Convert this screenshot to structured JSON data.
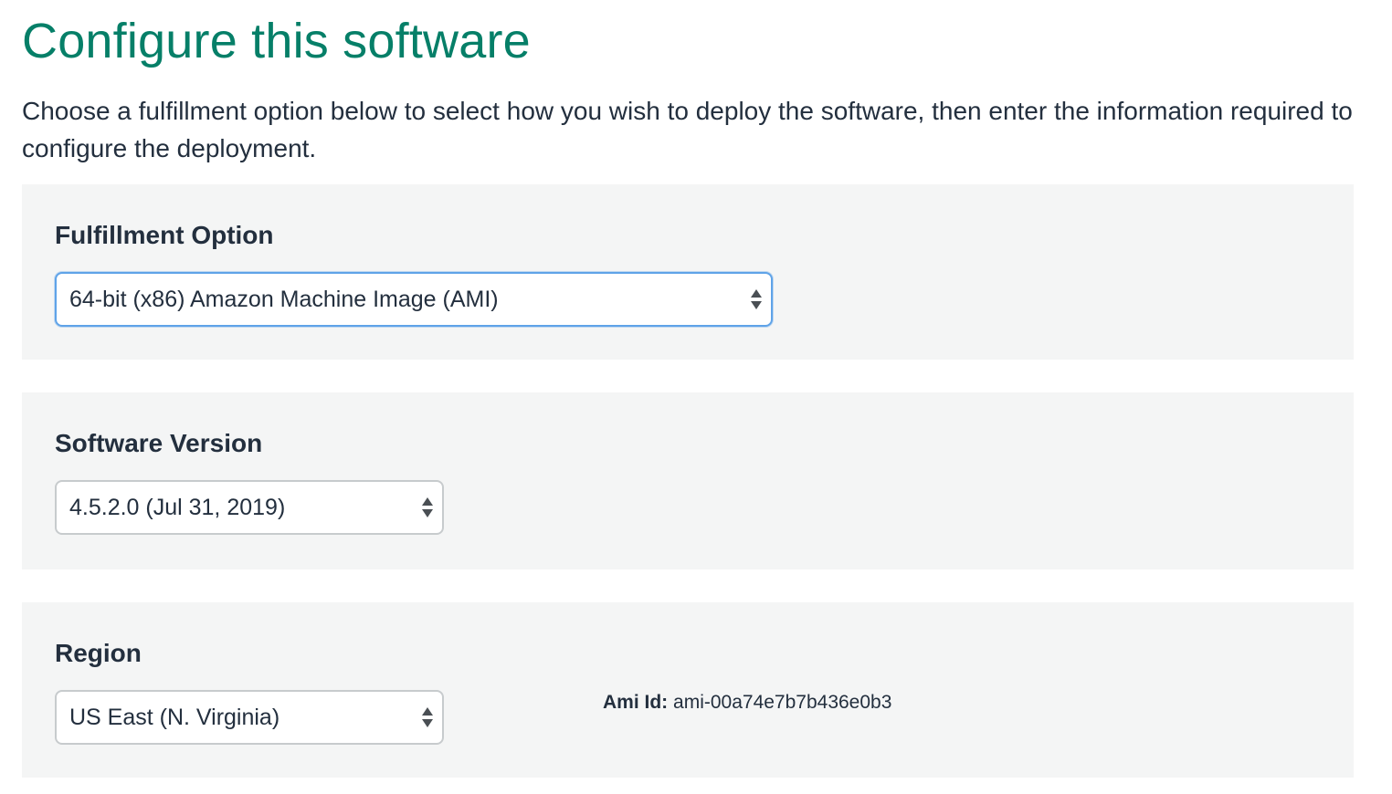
{
  "page": {
    "title": "Configure this software",
    "intro": "Choose a fulfillment option below to select how you wish to deploy the software, then enter the information required to configure the deployment."
  },
  "fulfillment": {
    "label": "Fulfillment Option",
    "selected": "64-bit (x86) Amazon Machine Image (AMI)"
  },
  "version": {
    "label": "Software Version",
    "selected": "4.5.2.0 (Jul 31, 2019)"
  },
  "region": {
    "label": "Region",
    "selected": "US East (N. Virginia)",
    "ami_label": "Ami Id:",
    "ami_value": "ami-00a74e7b7b436e0b3"
  },
  "colors": {
    "title": "#067f68",
    "text": "#232f3e",
    "panel_bg": "#f4f5f5",
    "focus_border": "#5fa3e8"
  },
  "icons": {
    "select_arrows": "up-down-arrows-icon"
  }
}
